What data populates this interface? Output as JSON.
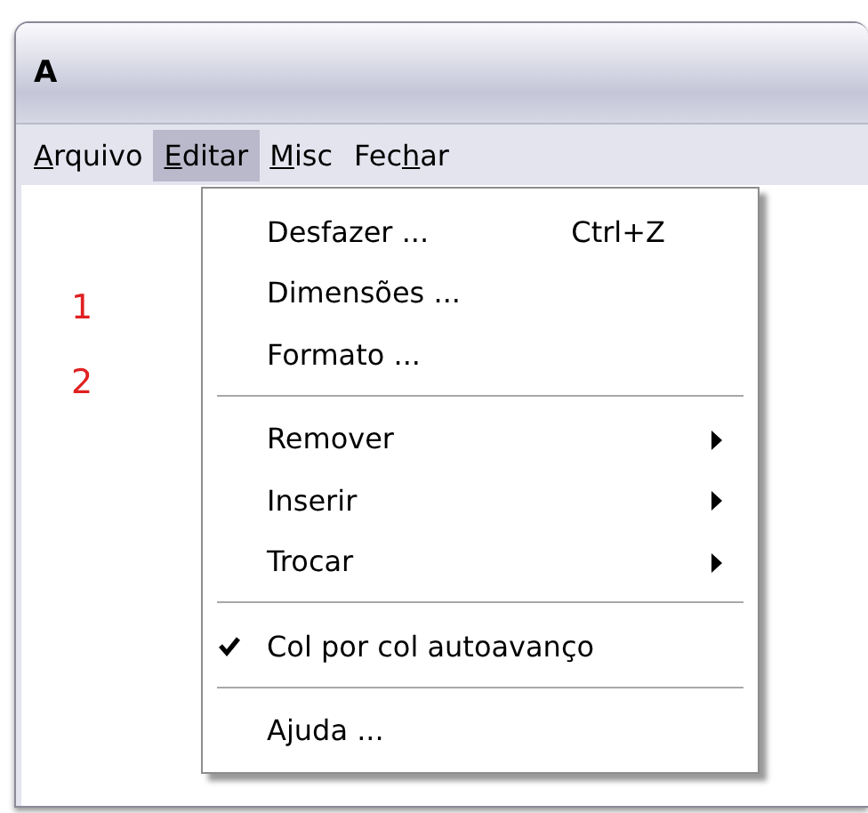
{
  "window": {
    "title": "A"
  },
  "menu_bar": [
    {
      "key": "A",
      "post": "rquivo",
      "selected": false
    },
    {
      "key": "E",
      "post": "ditar",
      "selected": true
    },
    {
      "key": "M",
      "post": "isc",
      "selected": false
    },
    {
      "pre": "Fec",
      "key": "h",
      "post": "ar",
      "selected": false
    }
  ],
  "content_labels": [
    "1",
    "2"
  ],
  "menu": [
    {
      "kind": "command",
      "label": "Desfazer ...",
      "shortcut": "Ctrl+Z"
    },
    {
      "kind": "command",
      "label": "Dimensões ..."
    },
    {
      "kind": "command",
      "label": "Formato ..."
    },
    {
      "kind": "separator"
    },
    {
      "kind": "submenu",
      "label": "Remover"
    },
    {
      "kind": "submenu",
      "label": "Inserir"
    },
    {
      "kind": "submenu",
      "label": "Trocar"
    },
    {
      "kind": "separator"
    },
    {
      "kind": "check",
      "label": "Col por col autoavanço",
      "checked": true
    },
    {
      "kind": "separator"
    },
    {
      "kind": "command",
      "label": "Ajuda ..."
    }
  ]
}
